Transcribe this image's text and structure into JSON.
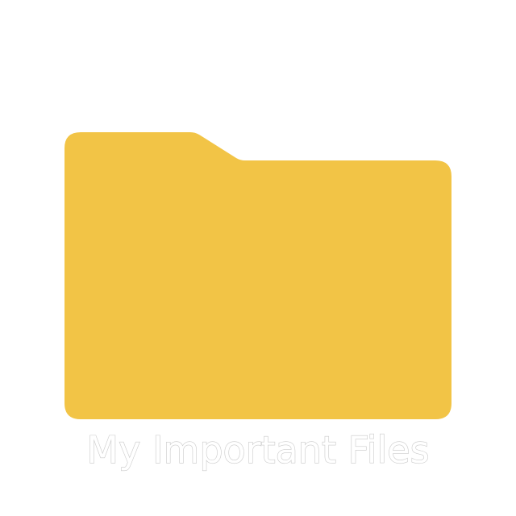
{
  "folder": {
    "name": "My Important Files",
    "icon": "folder-icon",
    "color": "#F2C446"
  }
}
